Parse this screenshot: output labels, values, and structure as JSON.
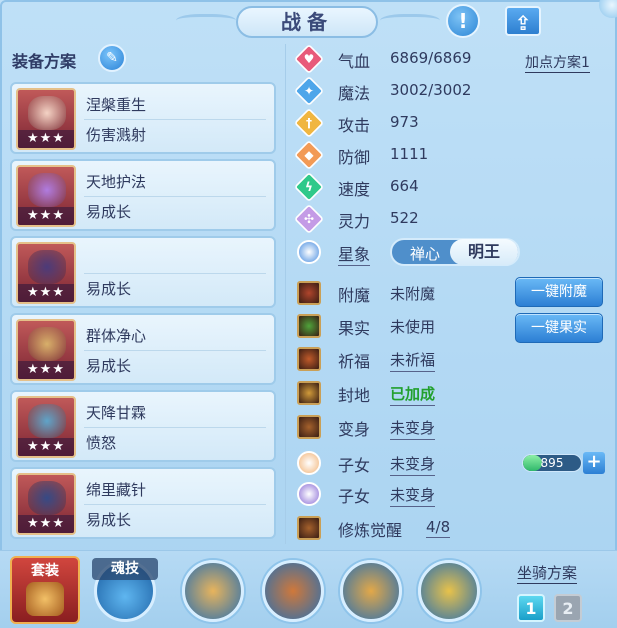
{
  "title": "战备",
  "colors": {
    "accent": "#2c82d6",
    "gold": "#e5c089",
    "green": "#22a02d"
  },
  "topbar": {
    "info_icon": "exclamation-icon",
    "share_icon": "share-icon",
    "info_glyph": "!",
    "share_glyph": "⇪"
  },
  "equipment": {
    "header": "装备方案",
    "edit_icon": "pencil-icon",
    "edit_glyph": "✎",
    "items": [
      {
        "name": "涅槃重生",
        "effect": "伤害溅射",
        "stars": "★★★",
        "art_color": "#f4d3c5"
      },
      {
        "name": "天地护法",
        "effect": "易成长",
        "stars": "★★★",
        "art_color": "#b07ce0"
      },
      {
        "name": "",
        "effect": "易成长",
        "stars": "★★★",
        "art_color": "#4c3b7a"
      },
      {
        "name": "群体净心",
        "effect": "易成长",
        "stars": "★★★",
        "art_color": "#d8b06a"
      },
      {
        "name": "天降甘霖",
        "effect": "愤怒",
        "stars": "★★★",
        "art_color": "#5fa4c9"
      },
      {
        "name": "绵里藏针",
        "effect": "易成长",
        "stars": "★★★",
        "art_color": "#364a86"
      }
    ]
  },
  "stats": {
    "plan_link": "加点方案1",
    "basic": [
      {
        "label": "气血",
        "value": "6869/6869",
        "icon": "heart-icon",
        "color": "#e85a7a",
        "glyph": "♥"
      },
      {
        "label": "魔法",
        "value": "3002/3002",
        "icon": "magic-icon",
        "color": "#4ea6ea",
        "glyph": "✦"
      },
      {
        "label": "攻击",
        "value": "973",
        "icon": "sword-icon",
        "color": "#f0b640",
        "glyph": "†"
      },
      {
        "label": "防御",
        "value": "1111",
        "icon": "shield-icon",
        "color": "#f29a56",
        "glyph": "◆"
      },
      {
        "label": "速度",
        "value": "664",
        "icon": "lightning-icon",
        "color": "#2fc98a",
        "glyph": "ϟ"
      },
      {
        "label": "灵力",
        "value": "522",
        "icon": "spirit-icon",
        "color": "#c49be6",
        "glyph": "✣"
      }
    ],
    "star_sign": {
      "label": "星象",
      "icon": "star-sign-icon",
      "off": "禅心",
      "on": "明王"
    },
    "extras": [
      {
        "label": "附魔",
        "value": "未附魔",
        "icon": "enchant-icon",
        "underline": false,
        "green": false,
        "color": "#b0452c"
      },
      {
        "label": "果实",
        "value": "未使用",
        "icon": "fruit-icon",
        "underline": false,
        "green": false,
        "color": "#4fa33b"
      },
      {
        "label": "祈福",
        "value": "未祈福",
        "icon": "pray-icon",
        "underline": true,
        "green": false,
        "color": "#c05a2a"
      },
      {
        "label": "封地",
        "value": "已加成",
        "icon": "fief-icon",
        "underline": true,
        "green": true,
        "color": "#d09a3a"
      },
      {
        "label": "变身",
        "value": "未变身",
        "icon": "transform-icon",
        "underline": true,
        "green": false,
        "color": "#a5612c"
      }
    ],
    "children": [
      {
        "label": "子女",
        "value": "未变身",
        "icon": "child-boy-icon",
        "color": "#f2b57a"
      },
      {
        "label": "子女",
        "value": "未变身",
        "icon": "child-girl-icon",
        "color": "#8c6fd6"
      }
    ],
    "cultivation": {
      "label": "修炼觉醒",
      "value": "4/8",
      "icon": "cultivation-icon",
      "color": "#a5612c"
    },
    "buttons": {
      "enchant": "一键附魔",
      "fruit": "一键果实"
    },
    "progress": {
      "value": "895",
      "fill_fraction": 0.32
    }
  },
  "bottom": {
    "suit_label": "套装",
    "soul_label": "魂技",
    "skills": [
      {
        "icon": "monk-skill-icon",
        "color": "#e8b45c"
      },
      {
        "icon": "scroll-skill-icon",
        "color": "#d0783a"
      },
      {
        "icon": "warrior-skill-icon",
        "color": "#e3a848"
      },
      {
        "icon": "golden-skill-icon",
        "color": "#e8c24a"
      }
    ],
    "mount_title": "坐骑方案",
    "mount_options": [
      "1",
      "2"
    ]
  }
}
